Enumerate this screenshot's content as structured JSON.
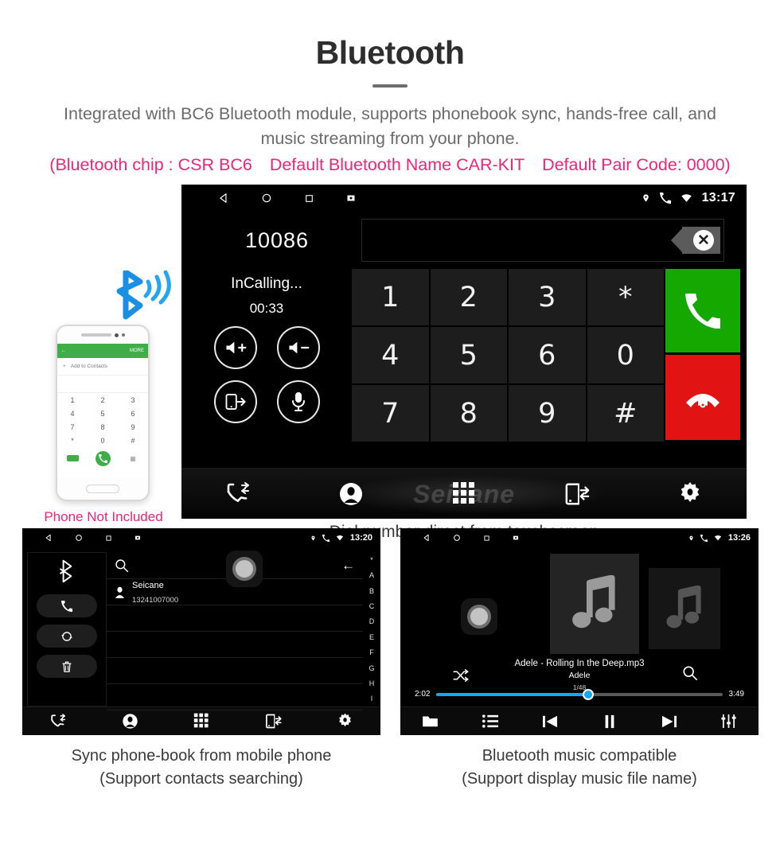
{
  "header": {
    "title": "Bluetooth",
    "subtitle": "Integrated with BC6 Bluetooth module, supports phonebook sync, hands-free call, and music streaming from your phone.",
    "spec_chip": "(Bluetooth chip : CSR BC6",
    "spec_name": "Default Bluetooth Name CAR-KIT",
    "spec_pair": "Default Pair Code: 0000)",
    "accent_color": "#f2247a",
    "text_color": "#6b6b6b"
  },
  "phone_mockup": {
    "caption": "Phone Not Included",
    "bar_more": "MORE",
    "bar_back": "←",
    "add_contacts": "Add to Contacts",
    "plus": "+",
    "keys": [
      "1",
      "2",
      "3",
      "4",
      "5",
      "6",
      "7",
      "8",
      "9",
      "*",
      "0",
      "#"
    ]
  },
  "dialer": {
    "status": {
      "time": "13:17"
    },
    "entered_number": "10086",
    "call_state": "InCalling...",
    "call_timer": "00:33",
    "controls": [
      {
        "name": "volume-up",
        "glyph": "vol-plus"
      },
      {
        "name": "volume-down",
        "glyph": "vol-minus"
      },
      {
        "name": "transfer-to-phone",
        "glyph": "phone-transfer"
      },
      {
        "name": "mute-microphone",
        "glyph": "mic"
      }
    ],
    "keypad": [
      "1",
      "2",
      "3",
      "*",
      "4",
      "5",
      "6",
      "0",
      "7",
      "8",
      "9",
      "#"
    ],
    "answer_color": "#15a800",
    "hangup_color": "#e21313",
    "watermark": "Seicane",
    "nav": [
      {
        "name": "call-log",
        "icon": "call-log-icon"
      },
      {
        "name": "contacts",
        "icon": "contact-icon"
      },
      {
        "name": "keypad",
        "icon": "keypad-grid-icon"
      },
      {
        "name": "phone-transfer",
        "icon": "phone-transfer-icon"
      },
      {
        "name": "settings",
        "icon": "gear-icon"
      }
    ],
    "caption": "Dial number direct from touchscreen"
  },
  "phonebook": {
    "status": {
      "time": "13:20"
    },
    "side_actions": [
      {
        "name": "bluetooth",
        "icon": "bluetooth-icon"
      },
      {
        "name": "call",
        "icon": "phone-icon"
      },
      {
        "name": "sync",
        "icon": "sync-icon"
      },
      {
        "name": "delete",
        "icon": "trash-icon"
      }
    ],
    "search_placeholder": "",
    "back_label": "←",
    "contacts": [
      {
        "name": "Seicane",
        "number": "13241007000"
      }
    ],
    "empty_rows": 4,
    "alpha_index": [
      "*",
      "A",
      "B",
      "C",
      "D",
      "E",
      "F",
      "G",
      "H",
      "I"
    ],
    "nav": [
      {
        "name": "call-log",
        "icon": "call-log-icon"
      },
      {
        "name": "contacts",
        "icon": "contact-icon"
      },
      {
        "name": "keypad",
        "icon": "keypad-grid-icon"
      },
      {
        "name": "phone-transfer",
        "icon": "phone-transfer-icon"
      },
      {
        "name": "settings",
        "icon": "gear-icon"
      }
    ],
    "caption_line1": "Sync phone-book from mobile phone",
    "caption_line2": "(Support contacts searching)"
  },
  "music": {
    "status": {
      "time": "13:26"
    },
    "track_title": "Adele - Rolling In the Deep.mp3",
    "artist": "Adele",
    "track_index": "1/48",
    "elapsed": "2:02",
    "duration": "3:49",
    "progress_percent": 53,
    "progress_color": "#13a7ef",
    "nav": [
      {
        "name": "folder",
        "icon": "folder-icon"
      },
      {
        "name": "playlist",
        "icon": "list-icon"
      },
      {
        "name": "previous",
        "icon": "previous-icon"
      },
      {
        "name": "pause",
        "icon": "pause-icon"
      },
      {
        "name": "next",
        "icon": "next-icon"
      },
      {
        "name": "equalizer",
        "icon": "equalizer-icon"
      }
    ],
    "caption_line1": "Bluetooth music compatible",
    "caption_line2": "(Support display music file name)"
  }
}
